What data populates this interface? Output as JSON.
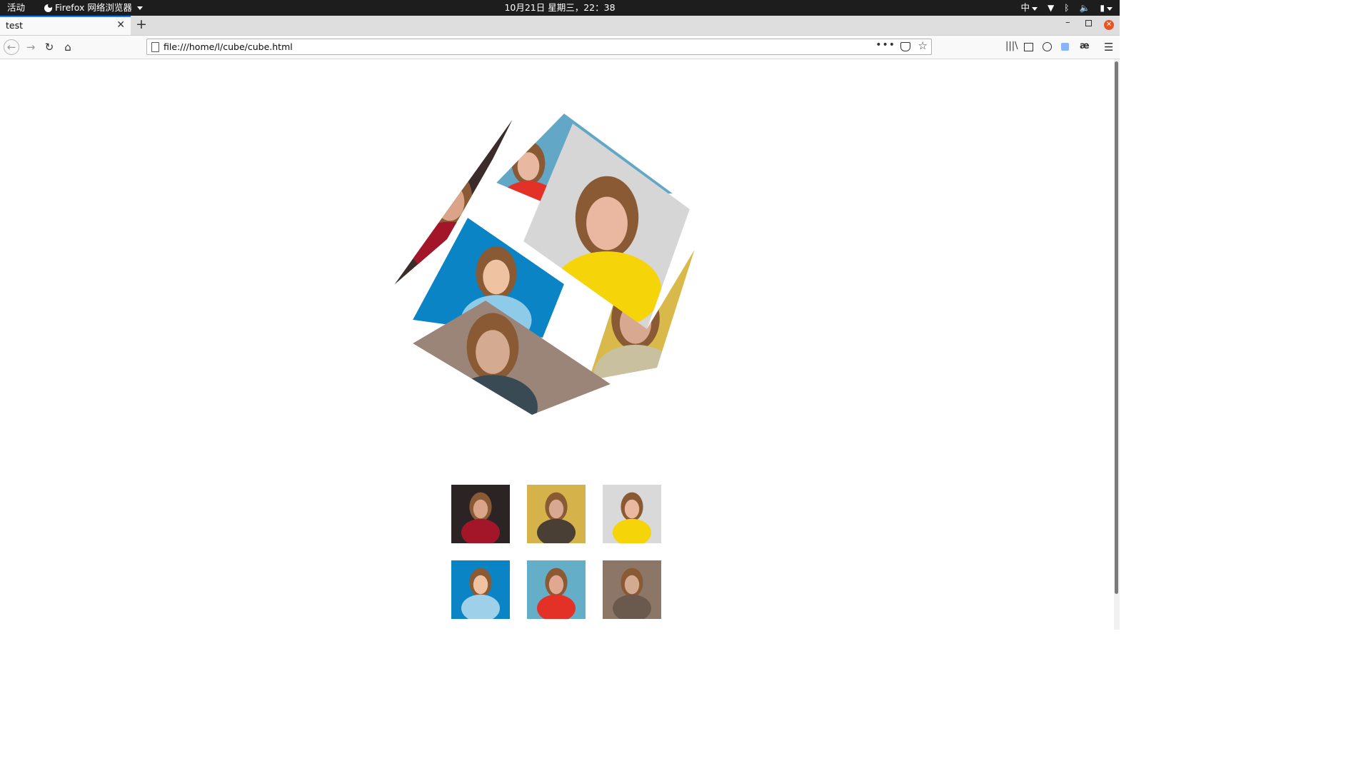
{
  "topbar": {
    "activities": "活动",
    "app_name": "Firefox 网络浏览器",
    "clock": "10月21日 星期三，22：38",
    "input_method": "中"
  },
  "browser": {
    "tab_title": "test",
    "url": "file:///home/l/cube/cube.html"
  },
  "page": {
    "cube_faces": [
      {
        "subject": "woman in red top, dark background",
        "colors": {
          "bg": "#3b2b2b",
          "main": "#a3162a",
          "skin": "#d9a488"
        }
      },
      {
        "subject": "woman with red lips, blue background",
        "colors": {
          "bg": "#62a8c6",
          "main": "#e33128",
          "skin": "#e8b8a0"
        }
      },
      {
        "subject": "smiling woman with glasses, yellow shirt",
        "colors": {
          "bg": "#d6d6d6",
          "main": "#f6d40a",
          "skin": "#eab8a0"
        }
      },
      {
        "subject": "blonde woman, yellow wall",
        "colors": {
          "bg": "#d9b94a",
          "main": "#c9c0a0",
          "skin": "#d8a890"
        }
      },
      {
        "subject": "woman with headphones, blue background",
        "colors": {
          "bg": "#0a84c4",
          "main": "#8ecbe8",
          "skin": "#efc2a2"
        }
      },
      {
        "subject": "woman in colorful sweater, brown background",
        "colors": {
          "bg": "#9a8578",
          "main": "#3a4a55",
          "skin": "#d4aa90"
        }
      }
    ],
    "thumbnails": [
      {
        "subject": "woman in red top",
        "colors": {
          "bg": "#2c2424",
          "main": "#a3162a",
          "skin": "#d9a488"
        }
      },
      {
        "subject": "blonde woman, yellow wall",
        "colors": {
          "bg": "#d6b34a",
          "main": "#4a3f35",
          "skin": "#d8a890"
        }
      },
      {
        "subject": "woman with glasses",
        "colors": {
          "bg": "#d9d9d9",
          "main": "#f6d40a",
          "skin": "#eab8a0"
        }
      },
      {
        "subject": "woman with headphones",
        "colors": {
          "bg": "#0a84c4",
          "main": "#9fd0ea",
          "skin": "#efc2a2"
        }
      },
      {
        "subject": "woman with red lips",
        "colors": {
          "bg": "#64aec8",
          "main": "#e33128",
          "skin": "#e0a890"
        }
      },
      {
        "subject": "woman in colorful sweater",
        "colors": {
          "bg": "#8c7668",
          "main": "#6a5a4e",
          "skin": "#d4aa90"
        }
      }
    ]
  }
}
